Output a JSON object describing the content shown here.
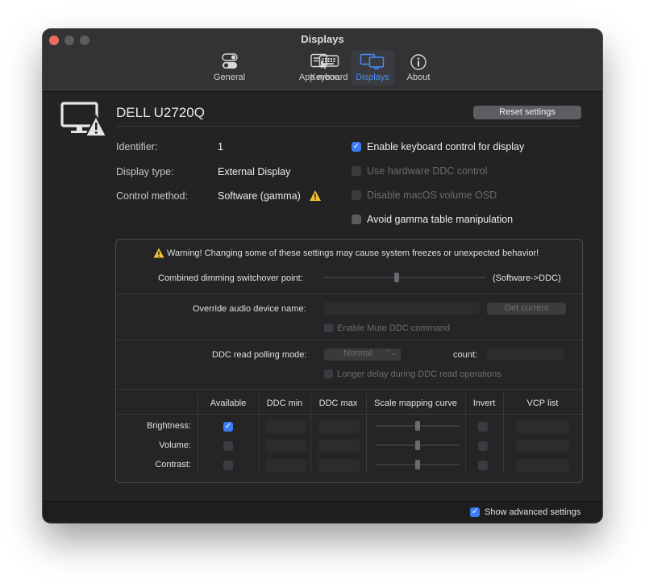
{
  "window": {
    "title": "Displays"
  },
  "toolbar": {
    "tabs": [
      {
        "label": "General",
        "icon": "toggles-icon"
      },
      {
        "label": "App menu",
        "icon": "app-menu-icon"
      },
      {
        "label": "Keyboard",
        "icon": "keyboard-icon"
      },
      {
        "label": "Displays",
        "icon": "displays-icon",
        "active": true
      },
      {
        "label": "About",
        "icon": "info-icon"
      }
    ]
  },
  "display": {
    "name": "DELL U2720Q",
    "reset_label": "Reset settings",
    "identifier_label": "Identifier:",
    "identifier_value": "1",
    "type_label": "Display type:",
    "type_value": "External Display",
    "method_label": "Control method:",
    "method_value": "Software (gamma)"
  },
  "options": {
    "keyboard_control": {
      "label": "Enable keyboard control for display",
      "checked": true,
      "enabled": true
    },
    "hardware_ddc": {
      "label": "Use hardware DDC control",
      "checked": false,
      "enabled": false
    },
    "disable_osd": {
      "label": "Disable macOS volume OSD",
      "checked": false,
      "enabled": false
    },
    "avoid_gamma": {
      "label": "Avoid gamma table manipulation",
      "checked": false,
      "enabled": true
    }
  },
  "advanced": {
    "warning": "Warning! Changing some of these settings may cause system freezes or unexpected behavior!",
    "dimming_label": "Combined dimming switchover point:",
    "dimming_suffix": "(Software->DDC)",
    "dimming_level": 0.45,
    "audio_label": "Override audio device name:",
    "audio_value": "",
    "get_current_label": "Get current",
    "mute_label": "Enable Mute DDC command",
    "polling_label": "DDC read polling mode:",
    "polling_value": "Normal",
    "count_label": "count:",
    "longer_delay_label": "Longer delay during DDC read operations"
  },
  "table": {
    "headers": {
      "available": "Available",
      "ddc_min": "DDC min",
      "ddc_max": "DDC max",
      "curve": "Scale mapping curve",
      "invert": "Invert",
      "vcp": "VCP list"
    },
    "rows": [
      {
        "label": "Brightness:",
        "available": true,
        "curve": 0.5
      },
      {
        "label": "Volume:",
        "available": false,
        "curve": 0.5
      },
      {
        "label": "Contrast:",
        "available": false,
        "curve": 0.5
      }
    ]
  },
  "footer": {
    "show_advanced_label": "Show advanced settings",
    "show_advanced_checked": true
  },
  "colors": {
    "accent": "#3d7cf5",
    "window_bg": "#232324",
    "warning": "#f2c12e"
  }
}
